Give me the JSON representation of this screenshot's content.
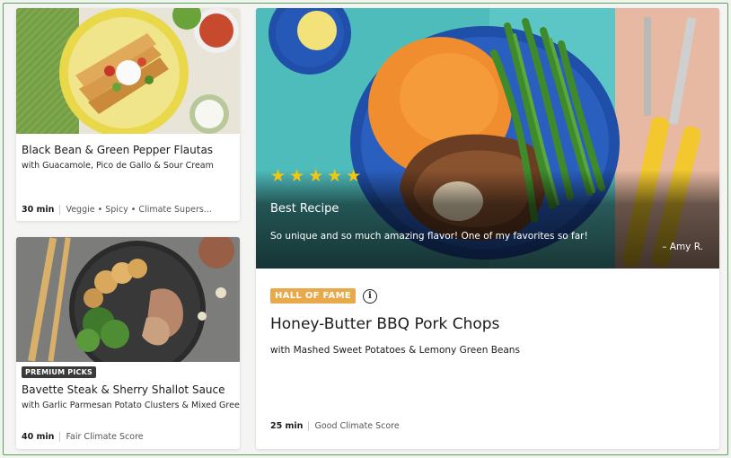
{
  "colors": {
    "frame_border": "#5aa35a",
    "star": "#f6c60e",
    "hall_of_fame_badge": "#e8a94a",
    "premium_badge": "#3a3a3a"
  },
  "recipes": [
    {
      "title": "Black Bean & Green Pepper Flautas",
      "subtitle": "with Guacamole, Pico de Gallo & Sour Cream",
      "time": "30 min",
      "tags": "Veggie • Spicy • Climate Supers..."
    },
    {
      "badge": "PREMIUM PICKS",
      "title": "Bavette Steak & Sherry Shallot Sauce",
      "subtitle": "with Garlic Parmesan Potato Clusters & Mixed Greens",
      "time": "40 min",
      "tags": "Fair Climate Score"
    }
  ],
  "featured": {
    "rating": 5,
    "stars": [
      "★",
      "★",
      "★",
      "★",
      "★"
    ],
    "label": "Best Recipe",
    "quote": "So unique and so much amazing flavor! One of my favorites so far!",
    "author": "– Amy R.",
    "badge": "HALL OF FAME",
    "info_icon": "i",
    "title": "Honey-Butter BBQ Pork Chops",
    "subtitle": "with Mashed Sweet Potatoes & Lemony Green Beans",
    "time": "25 min",
    "tags": "Good Climate Score"
  }
}
